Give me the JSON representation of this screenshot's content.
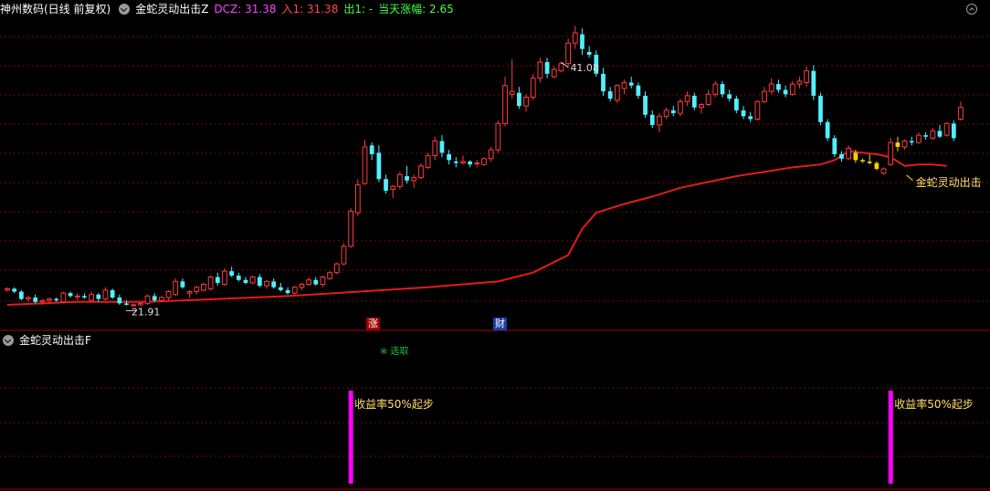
{
  "main_header": {
    "stock": "神州数码(日线 前复权)",
    "indicator": "金蛇灵动出击Z",
    "dcz": "DCZ: 31.38",
    "entry": "入1: 31.38",
    "exit": "出1: -",
    "change": "当天涨幅: 2.65"
  },
  "sub_header": {
    "indicator": "金蛇灵动出击F"
  },
  "annotations": {
    "max_label": "41.08",
    "min_label": "21.91",
    "signal_label": "金蛇灵动出击",
    "sub_tag": "※ 选取",
    "yield_left": "收益率50%起步",
    "yield_right": "收益率50%起步"
  },
  "badges": {
    "limit_up": "涨",
    "finance": "财"
  },
  "colors": {
    "up": "#ff3b3b",
    "down": "#4ff0ff",
    "ma": "#e41b1b",
    "signal": "#ff00ff",
    "grid": "#7a0a0a",
    "gold": "#ffd000"
  },
  "chart_data": {
    "type": "candlestick",
    "ylim": [
      21.5,
      41.6
    ],
    "candles": [
      {
        "o": 23.0,
        "h": 23.2,
        "l": 22.9,
        "c": 23.1
      },
      {
        "o": 23.1,
        "h": 23.2,
        "l": 22.8,
        "c": 22.9
      },
      {
        "o": 22.9,
        "h": 23.0,
        "l": 22.3,
        "c": 22.4
      },
      {
        "o": 22.4,
        "h": 22.6,
        "l": 22.2,
        "c": 22.5
      },
      {
        "o": 22.5,
        "h": 22.7,
        "l": 22.1,
        "c": 22.2
      },
      {
        "o": 22.2,
        "h": 22.4,
        "l": 22.0,
        "c": 22.3
      },
      {
        "o": 22.3,
        "h": 22.5,
        "l": 22.1,
        "c": 22.4
      },
      {
        "o": 22.4,
        "h": 22.5,
        "l": 22.2,
        "c": 22.3
      },
      {
        "o": 22.2,
        "h": 22.9,
        "l": 22.1,
        "c": 22.8
      },
      {
        "o": 22.8,
        "h": 22.9,
        "l": 22.5,
        "c": 22.6
      },
      {
        "o": 22.6,
        "h": 22.8,
        "l": 22.3,
        "c": 22.6
      },
      {
        "o": 22.6,
        "h": 22.8,
        "l": 22.4,
        "c": 22.5
      },
      {
        "o": 22.3,
        "h": 22.9,
        "l": 22.2,
        "c": 22.7
      },
      {
        "o": 22.7,
        "h": 22.8,
        "l": 22.2,
        "c": 22.4
      },
      {
        "o": 22.4,
        "h": 23.2,
        "l": 22.3,
        "c": 23.0
      },
      {
        "o": 23.0,
        "h": 23.1,
        "l": 22.4,
        "c": 22.5
      },
      {
        "o": 22.5,
        "h": 22.7,
        "l": 22.0,
        "c": 22.1
      },
      {
        "o": 22.1,
        "h": 22.3,
        "l": 21.95,
        "c": 22.0
      },
      {
        "o": 22.0,
        "h": 22.1,
        "l": 21.9,
        "c": 22.0
      },
      {
        "o": 22.0,
        "h": 22.2,
        "l": 21.91,
        "c": 22.1
      },
      {
        "o": 22.1,
        "h": 22.7,
        "l": 22.0,
        "c": 22.6
      },
      {
        "o": 22.6,
        "h": 22.8,
        "l": 22.2,
        "c": 22.3
      },
      {
        "o": 22.3,
        "h": 22.6,
        "l": 22.2,
        "c": 22.5
      },
      {
        "o": 22.5,
        "h": 23.0,
        "l": 22.3,
        "c": 22.9
      },
      {
        "o": 22.7,
        "h": 23.8,
        "l": 22.6,
        "c": 23.6
      },
      {
        "o": 23.6,
        "h": 23.8,
        "l": 23.1,
        "c": 23.2
      },
      {
        "o": 22.8,
        "h": 23.0,
        "l": 22.5,
        "c": 22.9
      },
      {
        "o": 22.9,
        "h": 23.3,
        "l": 22.7,
        "c": 23.2
      },
      {
        "o": 23.0,
        "h": 23.5,
        "l": 22.9,
        "c": 23.4
      },
      {
        "o": 23.1,
        "h": 24.0,
        "l": 23.0,
        "c": 23.9
      },
      {
        "o": 23.9,
        "h": 24.2,
        "l": 23.3,
        "c": 23.5
      },
      {
        "o": 23.4,
        "h": 24.5,
        "l": 23.3,
        "c": 24.3
      },
      {
        "o": 24.3,
        "h": 24.6,
        "l": 23.9,
        "c": 24.0
      },
      {
        "o": 24.0,
        "h": 24.2,
        "l": 23.6,
        "c": 23.7
      },
      {
        "o": 23.7,
        "h": 23.9,
        "l": 23.4,
        "c": 23.5
      },
      {
        "o": 23.5,
        "h": 24.0,
        "l": 23.4,
        "c": 23.9
      },
      {
        "o": 23.9,
        "h": 24.1,
        "l": 23.2,
        "c": 23.3
      },
      {
        "o": 23.3,
        "h": 23.7,
        "l": 23.1,
        "c": 23.6
      },
      {
        "o": 23.6,
        "h": 23.8,
        "l": 23.1,
        "c": 23.2
      },
      {
        "o": 23.2,
        "h": 23.5,
        "l": 22.9,
        "c": 23.0
      },
      {
        "o": 23.0,
        "h": 23.2,
        "l": 22.7,
        "c": 22.8
      },
      {
        "o": 22.8,
        "h": 23.3,
        "l": 22.7,
        "c": 23.2
      },
      {
        "o": 23.2,
        "h": 23.5,
        "l": 23.0,
        "c": 23.4
      },
      {
        "o": 23.4,
        "h": 23.9,
        "l": 23.3,
        "c": 23.7
      },
      {
        "o": 23.7,
        "h": 23.9,
        "l": 23.3,
        "c": 23.4
      },
      {
        "o": 23.4,
        "h": 24.0,
        "l": 23.2,
        "c": 23.9
      },
      {
        "o": 23.8,
        "h": 24.3,
        "l": 23.7,
        "c": 24.2
      },
      {
        "o": 24.2,
        "h": 24.9,
        "l": 24.1,
        "c": 24.8
      },
      {
        "o": 24.8,
        "h": 26.2,
        "l": 24.7,
        "c": 26.0
      },
      {
        "o": 26.0,
        "h": 28.6,
        "l": 25.9,
        "c": 28.4
      },
      {
        "o": 28.3,
        "h": 30.6,
        "l": 28.1,
        "c": 30.2
      },
      {
        "o": 30.3,
        "h": 33.3,
        "l": 30.2,
        "c": 32.8
      },
      {
        "o": 32.9,
        "h": 33.1,
        "l": 31.9,
        "c": 32.3
      },
      {
        "o": 32.4,
        "h": 32.9,
        "l": 30.4,
        "c": 30.6
      },
      {
        "o": 30.6,
        "h": 30.9,
        "l": 29.6,
        "c": 29.8
      },
      {
        "o": 29.9,
        "h": 30.2,
        "l": 29.3,
        "c": 30.1
      },
      {
        "o": 30.1,
        "h": 31.1,
        "l": 29.9,
        "c": 30.9
      },
      {
        "o": 30.8,
        "h": 31.5,
        "l": 30.3,
        "c": 30.5
      },
      {
        "o": 30.5,
        "h": 30.9,
        "l": 30.0,
        "c": 30.7
      },
      {
        "o": 30.7,
        "h": 31.7,
        "l": 30.6,
        "c": 31.5
      },
      {
        "o": 31.4,
        "h": 32.4,
        "l": 31.3,
        "c": 32.2
      },
      {
        "o": 32.2,
        "h": 33.5,
        "l": 31.9,
        "c": 33.2
      },
      {
        "o": 33.2,
        "h": 33.6,
        "l": 32.1,
        "c": 32.4
      },
      {
        "o": 32.3,
        "h": 32.6,
        "l": 31.6,
        "c": 31.9
      },
      {
        "o": 31.8,
        "h": 32.1,
        "l": 31.4,
        "c": 31.7
      },
      {
        "o": 31.7,
        "h": 32.2,
        "l": 31.6,
        "c": 31.8
      },
      {
        "o": 31.8,
        "h": 31.9,
        "l": 31.4,
        "c": 31.6
      },
      {
        "o": 31.7,
        "h": 31.9,
        "l": 31.4,
        "c": 31.7
      },
      {
        "o": 31.6,
        "h": 32.1,
        "l": 31.5,
        "c": 32.0
      },
      {
        "o": 32.0,
        "h": 32.8,
        "l": 31.8,
        "c": 32.6
      },
      {
        "o": 32.6,
        "h": 34.6,
        "l": 32.4,
        "c": 34.4
      },
      {
        "o": 34.4,
        "h": 37.6,
        "l": 34.2,
        "c": 37.0
      },
      {
        "o": 36.4,
        "h": 38.8,
        "l": 36.1,
        "c": 36.6
      },
      {
        "o": 36.5,
        "h": 36.9,
        "l": 35.4,
        "c": 35.6
      },
      {
        "o": 35.6,
        "h": 36.4,
        "l": 35.2,
        "c": 36.2
      },
      {
        "o": 36.2,
        "h": 37.8,
        "l": 36.0,
        "c": 37.5
      },
      {
        "o": 37.5,
        "h": 38.9,
        "l": 37.2,
        "c": 38.6
      },
      {
        "o": 38.6,
        "h": 38.9,
        "l": 37.5,
        "c": 37.8
      },
      {
        "o": 37.6,
        "h": 38.3,
        "l": 37.5,
        "c": 38.1
      },
      {
        "o": 38.0,
        "h": 38.6,
        "l": 37.9,
        "c": 38.5
      },
      {
        "o": 38.5,
        "h": 40.2,
        "l": 38.3,
        "c": 39.9
      },
      {
        "o": 39.9,
        "h": 41.08,
        "l": 39.5,
        "c": 40.6
      },
      {
        "o": 40.5,
        "h": 40.9,
        "l": 39.1,
        "c": 39.5
      },
      {
        "o": 39.3,
        "h": 39.7,
        "l": 38.9,
        "c": 39.1
      },
      {
        "o": 39.1,
        "h": 39.4,
        "l": 37.6,
        "c": 37.8
      },
      {
        "o": 37.8,
        "h": 38.2,
        "l": 36.3,
        "c": 36.6
      },
      {
        "o": 36.6,
        "h": 36.9,
        "l": 35.9,
        "c": 36.1
      },
      {
        "o": 36.0,
        "h": 37.1,
        "l": 35.8,
        "c": 37.0
      },
      {
        "o": 36.8,
        "h": 37.4,
        "l": 36.4,
        "c": 37.2
      },
      {
        "o": 37.2,
        "h": 37.6,
        "l": 36.8,
        "c": 37.0
      },
      {
        "o": 37.0,
        "h": 37.2,
        "l": 36.1,
        "c": 36.3
      },
      {
        "o": 36.3,
        "h": 36.6,
        "l": 34.8,
        "c": 35.0
      },
      {
        "o": 35.0,
        "h": 35.3,
        "l": 34.1,
        "c": 34.3
      },
      {
        "o": 34.3,
        "h": 35.1,
        "l": 33.8,
        "c": 34.9
      },
      {
        "o": 34.9,
        "h": 35.5,
        "l": 34.7,
        "c": 35.3
      },
      {
        "o": 35.3,
        "h": 35.6,
        "l": 34.9,
        "c": 35.1
      },
      {
        "o": 35.1,
        "h": 36.1,
        "l": 34.9,
        "c": 35.9
      },
      {
        "o": 35.9,
        "h": 36.6,
        "l": 35.6,
        "c": 36.3
      },
      {
        "o": 36.3,
        "h": 36.5,
        "l": 35.3,
        "c": 35.5
      },
      {
        "o": 35.5,
        "h": 35.8,
        "l": 35.1,
        "c": 35.7
      },
      {
        "o": 35.7,
        "h": 36.7,
        "l": 35.6,
        "c": 36.4
      },
      {
        "o": 36.4,
        "h": 37.3,
        "l": 36.2,
        "c": 37.1
      },
      {
        "o": 37.1,
        "h": 37.3,
        "l": 36.2,
        "c": 36.4
      },
      {
        "o": 36.4,
        "h": 36.7,
        "l": 35.9,
        "c": 36.1
      },
      {
        "o": 36.1,
        "h": 36.3,
        "l": 35.1,
        "c": 35.3
      },
      {
        "o": 35.3,
        "h": 35.6,
        "l": 34.7,
        "c": 34.9
      },
      {
        "o": 34.9,
        "h": 35.2,
        "l": 34.5,
        "c": 34.7
      },
      {
        "o": 34.7,
        "h": 36.0,
        "l": 34.6,
        "c": 35.9
      },
      {
        "o": 35.9,
        "h": 36.9,
        "l": 35.8,
        "c": 36.6
      },
      {
        "o": 36.6,
        "h": 37.5,
        "l": 36.4,
        "c": 37.1
      },
      {
        "o": 37.1,
        "h": 37.4,
        "l": 36.5,
        "c": 36.7
      },
      {
        "o": 36.7,
        "h": 37.0,
        "l": 36.2,
        "c": 36.4
      },
      {
        "o": 36.4,
        "h": 37.3,
        "l": 36.3,
        "c": 37.1
      },
      {
        "o": 37.1,
        "h": 37.6,
        "l": 36.8,
        "c": 37.3
      },
      {
        "o": 37.2,
        "h": 38.3,
        "l": 36.9,
        "c": 38.0
      },
      {
        "o": 38.0,
        "h": 38.4,
        "l": 36.0,
        "c": 36.3
      },
      {
        "o": 36.3,
        "h": 36.5,
        "l": 34.3,
        "c": 34.5
      },
      {
        "o": 34.5,
        "h": 34.7,
        "l": 33.2,
        "c": 33.4
      },
      {
        "o": 33.4,
        "h": 33.6,
        "l": 32.1,
        "c": 32.3
      },
      {
        "o": 32.3,
        "h": 32.5,
        "l": 31.8,
        "c": 32.0
      },
      {
        "o": 32.0,
        "h": 32.9,
        "l": 31.9,
        "c": 32.7
      },
      {
        "o": 32.4,
        "h": 32.6,
        "l": 31.7,
        "c": 31.9
      },
      {
        "o": 31.9,
        "h": 32.0,
        "l": 31.7,
        "c": 31.8
      },
      {
        "o": 31.8,
        "h": 32.3,
        "l": 31.6,
        "c": 31.7
      },
      {
        "o": 31.7,
        "h": 31.8,
        "l": 31.2,
        "c": 31.3
      },
      {
        "o": 31.0,
        "h": 31.4,
        "l": 30.9,
        "c": 31.3
      },
      {
        "o": 31.6,
        "h": 33.4,
        "l": 31.5,
        "c": 33.1
      },
      {
        "o": 33.1,
        "h": 33.5,
        "l": 32.5,
        "c": 32.8
      },
      {
        "o": 32.8,
        "h": 33.3,
        "l": 32.6,
        "c": 33.2
      },
      {
        "o": 33.2,
        "h": 33.5,
        "l": 32.9,
        "c": 33.1
      },
      {
        "o": 33.1,
        "h": 33.8,
        "l": 33.0,
        "c": 33.6
      },
      {
        "o": 33.6,
        "h": 33.8,
        "l": 33.3,
        "c": 33.5
      },
      {
        "o": 33.4,
        "h": 34.1,
        "l": 33.3,
        "c": 33.9
      },
      {
        "o": 33.9,
        "h": 34.3,
        "l": 33.4,
        "c": 33.5
      },
      {
        "o": 33.6,
        "h": 34.5,
        "l": 33.5,
        "c": 34.4
      },
      {
        "o": 34.4,
        "h": 34.6,
        "l": 33.2,
        "c": 33.4
      },
      {
        "o": 34.7,
        "h": 35.9,
        "l": 34.6,
        "c": 35.5
      }
    ],
    "ma": [
      [
        0,
        22.0
      ],
      [
        10,
        22.2
      ],
      [
        20,
        22.2
      ],
      [
        30,
        22.4
      ],
      [
        40,
        22.6
      ],
      [
        50,
        22.9
      ],
      [
        60,
        23.2
      ],
      [
        70,
        23.6
      ],
      [
        75,
        24.2
      ],
      [
        80,
        25.4
      ],
      [
        82,
        27.2
      ],
      [
        84,
        28.3
      ],
      [
        88,
        28.9
      ],
      [
        92,
        29.4
      ],
      [
        96,
        30.0
      ],
      [
        100,
        30.4
      ],
      [
        104,
        30.8
      ],
      [
        108,
        31.1
      ],
      [
        112,
        31.4
      ],
      [
        116,
        31.6
      ],
      [
        118,
        31.9
      ],
      [
        120,
        32.5
      ],
      [
        124,
        32.3
      ],
      [
        126,
        32.1
      ],
      [
        128,
        31.5
      ],
      [
        130,
        31.6
      ],
      [
        132,
        31.6
      ],
      [
        134,
        31.5
      ]
    ],
    "gold_segment": [
      120,
      127
    ],
    "signal_bars": [
      {
        "index": 49
      },
      {
        "index": 126
      }
    ],
    "max_index": 79,
    "min_index": 19
  }
}
